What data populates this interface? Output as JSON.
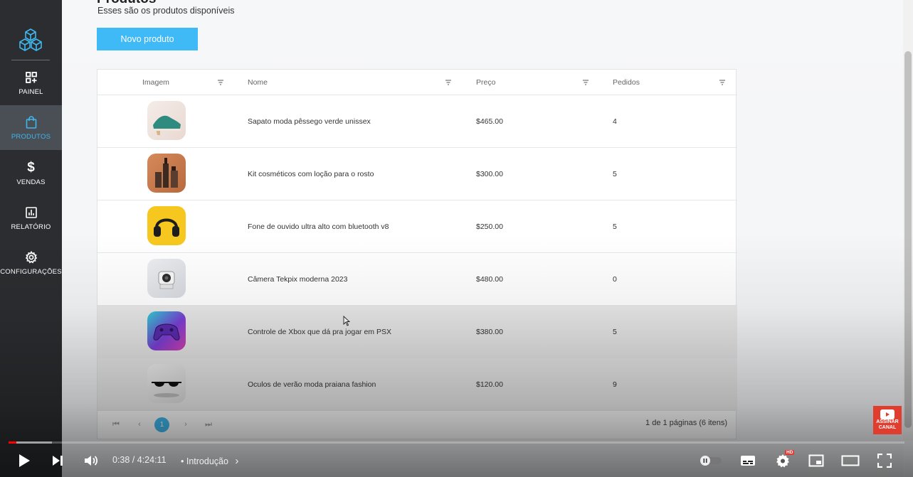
{
  "sidebar": {
    "items": [
      {
        "label": "PAINEL",
        "icon": "dashboard-icon"
      },
      {
        "label": "PRODUTOS",
        "icon": "shopping-bag-icon"
      },
      {
        "label": "VENDAS",
        "icon": "dollar-icon"
      },
      {
        "label": "RELATÓRIO",
        "icon": "report-chart-icon"
      },
      {
        "label": "CONFIGURAÇÕES",
        "icon": "gear-icon"
      }
    ],
    "active": "PRODUTOS",
    "accent": "#3fb8ef"
  },
  "header": {
    "title": "Produtos",
    "subtitle": "Esses são os produtos disponíveis",
    "new_button": "Novo produto"
  },
  "table": {
    "columns": [
      "Imagem",
      "Nome",
      "Preço",
      "Pedidos"
    ],
    "rows": [
      {
        "image": "shoe",
        "name": "Sapato moda pêssego verde unissex",
        "price": "$465.00",
        "orders": "4"
      },
      {
        "image": "cosmetics",
        "name": "Kit cosméticos com loção para o rosto",
        "price": "$300.00",
        "orders": "5"
      },
      {
        "image": "headphones",
        "name": "Fone de ouvido ultra alto com bluetooth v8",
        "price": "$250.00",
        "orders": "5"
      },
      {
        "image": "camera",
        "name": "Câmera Tekpix moderna 2023",
        "price": "$480.00",
        "orders": "0"
      },
      {
        "image": "controller",
        "name": "Controle de Xbox que dá pra jogar em PSX",
        "price": "$380.00",
        "orders": "5"
      },
      {
        "image": "sunglasses",
        "name": "Oculos de verão moda praiana fashion",
        "price": "$120.00",
        "orders": "9"
      }
    ],
    "pagination": {
      "first": "⏮",
      "prev": "‹",
      "current": "1",
      "next": "›",
      "last": "⏭",
      "info": "1 de 1 páginas (6 itens)"
    }
  },
  "player": {
    "time": "0:38 / 4:24:11",
    "chapter": "• Introdução",
    "chapter_arrow": "›",
    "hd_badge": "HD",
    "subscribe": [
      "ASSINAR",
      "CANAL"
    ],
    "progress_fraction": 0.0087
  }
}
